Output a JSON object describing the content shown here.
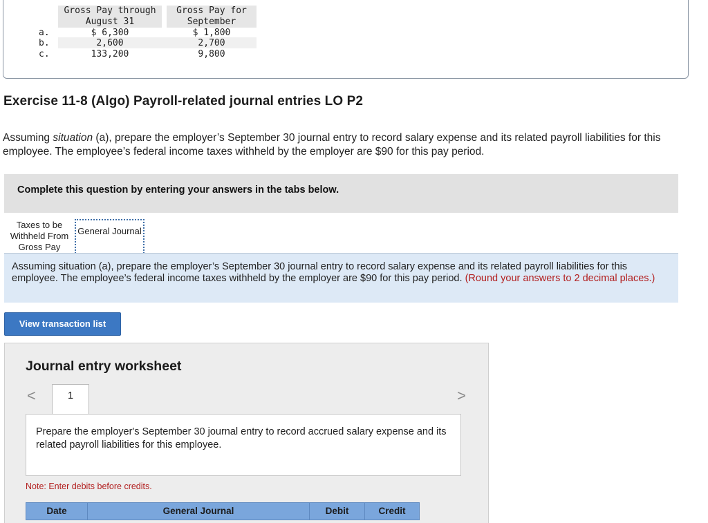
{
  "top_table": {
    "headers": [
      [
        "Gross Pay through",
        "August 31"
      ],
      [
        "Gross Pay for",
        "September"
      ]
    ],
    "rows": [
      {
        "label": "a.",
        "through": "$ 6,300",
        "september": "$ 1,800"
      },
      {
        "label": "b.",
        "through": "2,600",
        "september": "2,700"
      },
      {
        "label": "c.",
        "through": "133,200",
        "september": "9,800"
      }
    ]
  },
  "exercise": {
    "title": "Exercise 11-8 (Algo) Payroll-related journal entries LO P2",
    "instruction_pre": "Assuming ",
    "instruction_italic": "situation",
    "instruction_post": " (a), prepare the employer’s September 30 journal entry to record salary expense and its related payroll liabilities for this employee. The employee’s federal income taxes withheld by the employer are $90 for this pay period."
  },
  "complete_bar": "Complete this question by entering your answers in the tabs below.",
  "tabs": [
    {
      "label": "Taxes to be Withheld From Gross Pay"
    },
    {
      "label": "General Journal"
    }
  ],
  "panel": {
    "text": "Assuming situation (a), prepare the employer’s September 30 journal entry to record salary expense and its related payroll liabilities for this employee. The employee’s federal income taxes withheld by the employer are $90 for this pay period.",
    "red_text": "(Round your answers to 2 decimal places.)"
  },
  "view_button": "View transaction list",
  "worksheet": {
    "title": "Journal entry worksheet",
    "prev_icon": "chevron-left-icon",
    "next_icon": "chevron-right-icon",
    "prev_glyph": "<",
    "next_glyph": ">",
    "page": "1",
    "prompt": "Prepare the employer's September 30 journal entry to record accrued salary expense and its related payroll liabilities for this employee.",
    "note": "Note: Enter debits before credits.",
    "columns": [
      "Date",
      "General Journal",
      "Debit",
      "Credit"
    ]
  }
}
